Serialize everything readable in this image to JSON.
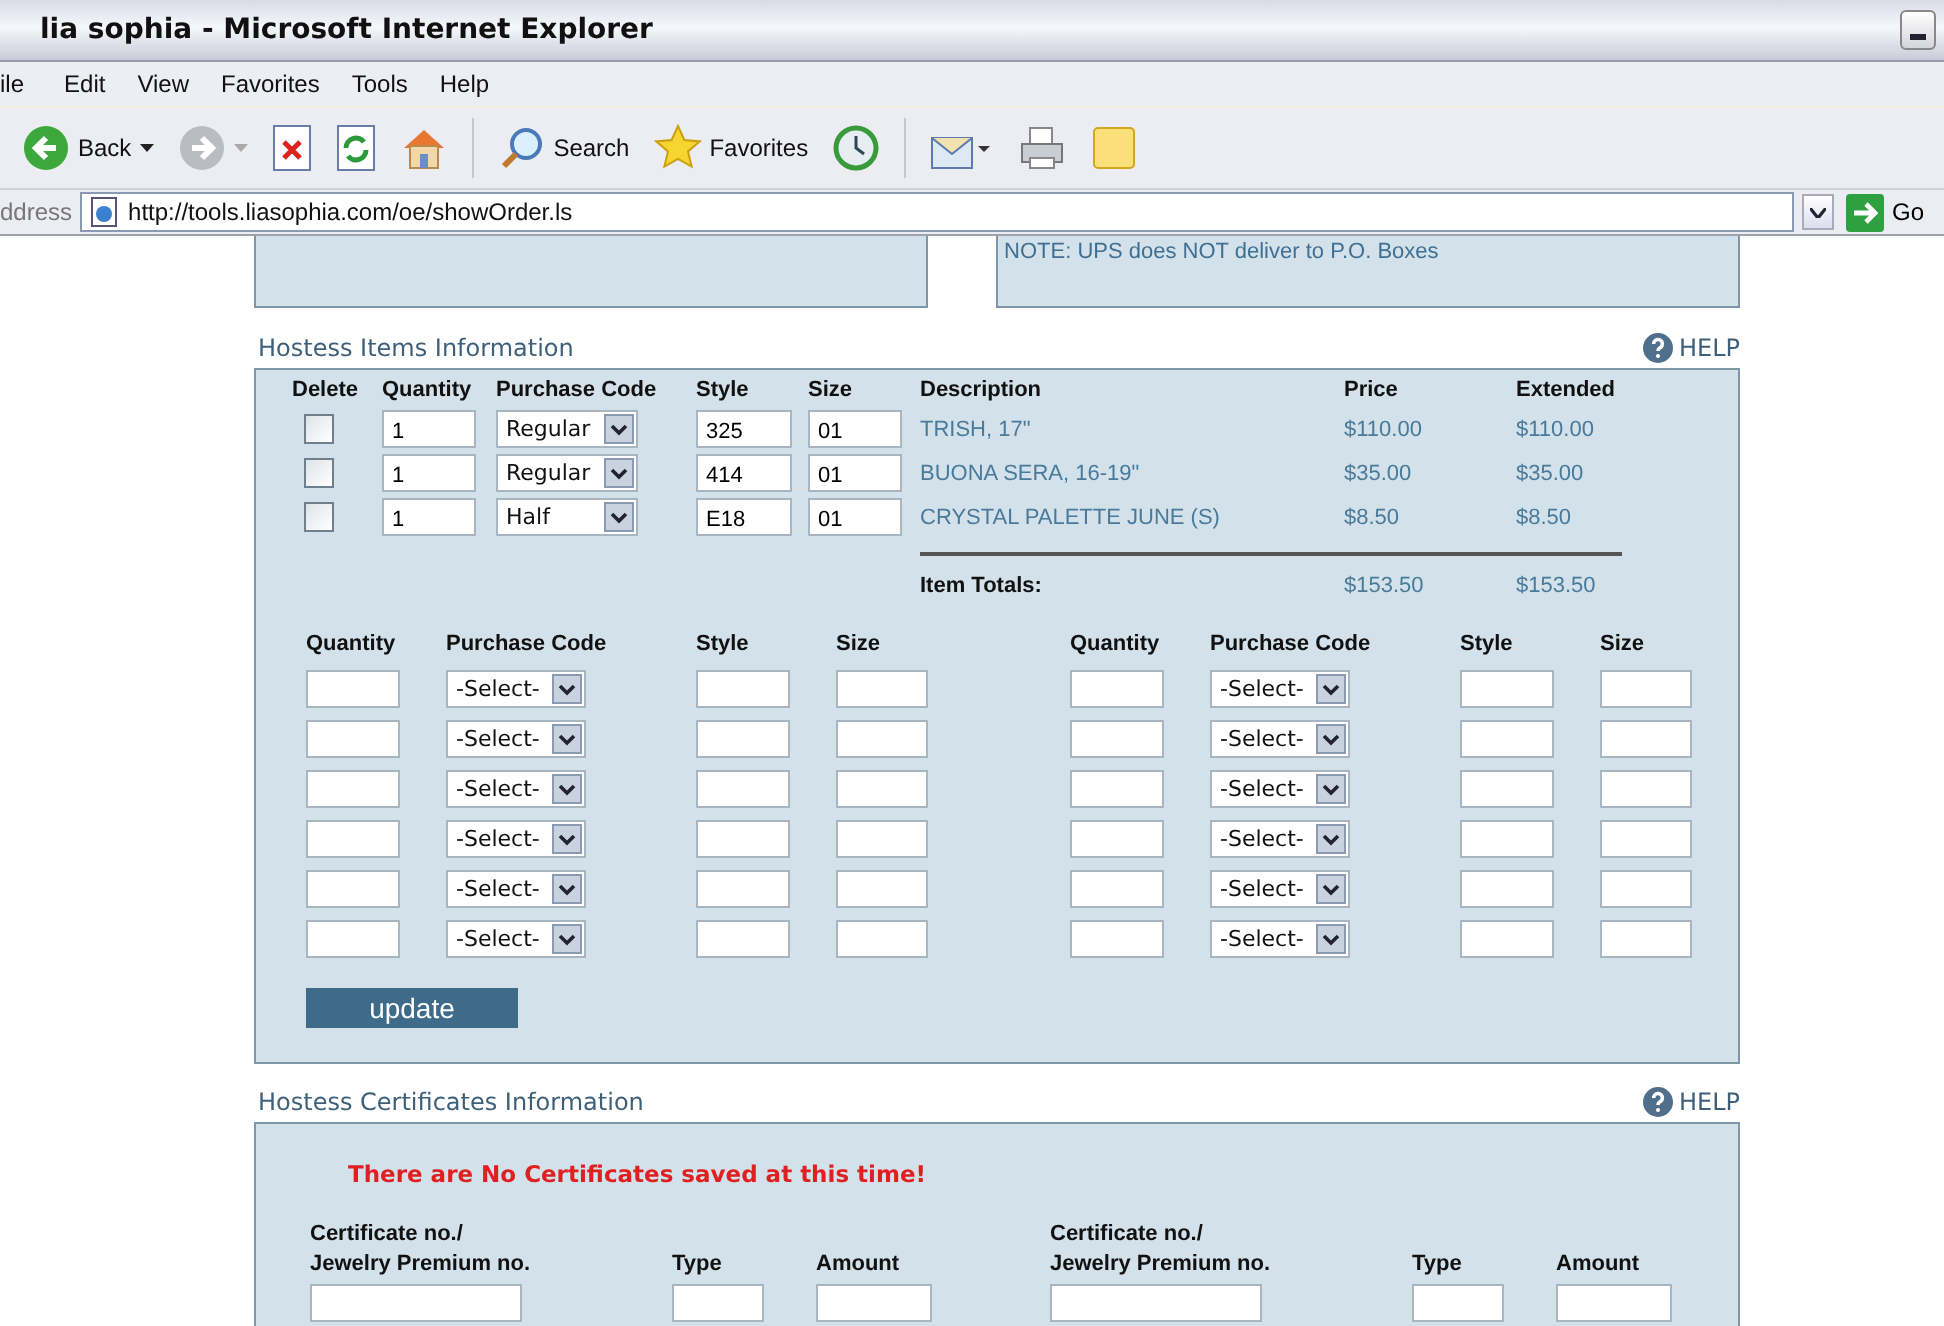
{
  "window": {
    "title": "lia sophia - Microsoft Internet Explorer"
  },
  "menu": [
    "ile",
    "Edit",
    "View",
    "Favorites",
    "Tools",
    "Help"
  ],
  "toolbar": [
    {
      "kind": "back",
      "label": "Back"
    },
    {
      "kind": "forward"
    },
    {
      "kind": "stop"
    },
    {
      "kind": "refresh"
    },
    {
      "kind": "home"
    },
    {
      "kind": "search",
      "label": "Search"
    },
    {
      "kind": "favorites",
      "label": "Favorites"
    },
    {
      "kind": "history"
    },
    {
      "kind": "mail"
    },
    {
      "kind": "print"
    },
    {
      "kind": "note"
    }
  ],
  "address": {
    "label": "ddress",
    "url": "http://tools.liasophia.com/oe/showOrder.ls",
    "go": "Go"
  },
  "shipping_note": "NOTE: UPS does NOT deliver to P.O. Boxes",
  "hostess_items": {
    "title": "Hostess Items Information",
    "help": "HELP",
    "columns": [
      "Delete",
      "Quantity",
      "Purchase Code",
      "Style",
      "Size",
      "Description",
      "Price",
      "Extended"
    ],
    "rows": [
      {
        "delete": false,
        "quantity": "1",
        "purchase_code": "Regular",
        "style": "325",
        "size": "01",
        "description": "TRISH, 17\"",
        "price": "$110.00",
        "extended": "$110.00"
      },
      {
        "delete": false,
        "quantity": "1",
        "purchase_code": "Regular",
        "style": "414",
        "size": "01",
        "description": "BUONA SERA, 16-19\"",
        "price": "$35.00",
        "extended": "$35.00"
      },
      {
        "delete": false,
        "quantity": "1",
        "purchase_code": "Half",
        "style": "E18",
        "size": "01",
        "description": "CRYSTAL PALETTE JUNE (S)",
        "price": "$8.50",
        "extended": "$8.50"
      }
    ],
    "totals": {
      "label": "Item Totals:",
      "price": "$153.50",
      "extended": "$153.50"
    },
    "entry_groups": [
      {
        "columns": [
          "Quantity",
          "Purchase Code",
          "Style",
          "Size"
        ],
        "rows": [
          {
            "purchase_code": "-Select-"
          },
          {
            "purchase_code": "-Select-"
          },
          {
            "purchase_code": "-Select-"
          },
          {
            "purchase_code": "-Select-"
          },
          {
            "purchase_code": "-Select-"
          },
          {
            "purchase_code": "-Select-"
          }
        ]
      },
      {
        "columns": [
          "Quantity",
          "Purchase Code",
          "Style",
          "Size"
        ],
        "rows": [
          {
            "purchase_code": "-Select-"
          },
          {
            "purchase_code": "-Select-"
          },
          {
            "purchase_code": "-Select-"
          },
          {
            "purchase_code": "-Select-"
          },
          {
            "purchase_code": "-Select-"
          },
          {
            "purchase_code": "-Select-"
          }
        ]
      }
    ],
    "update_button": "update"
  },
  "certificates": {
    "title": "Hostess Certificates Information",
    "help": "HELP",
    "message": "There are No Certificates saved at this time!",
    "groups": [
      {
        "columns": [
          "Certificate no./\nJewelry Premium no.",
          "Type",
          "Amount"
        ]
      },
      {
        "columns": [
          "Certificate no./\nJewelry Premium no.",
          "Type",
          "Amount"
        ]
      }
    ]
  }
}
